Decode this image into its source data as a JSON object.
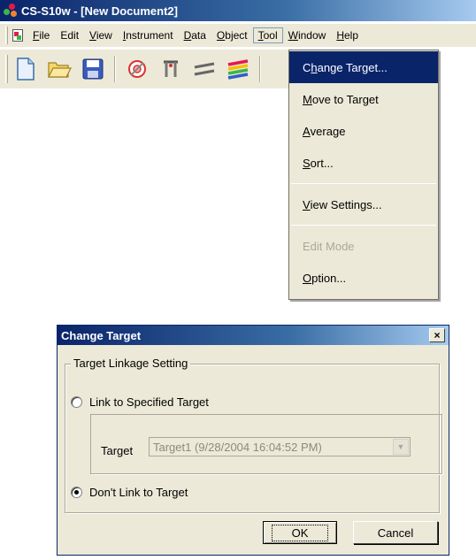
{
  "window": {
    "title": "CS-S10w - [New Document2]"
  },
  "menubar": {
    "items": [
      {
        "label": "File",
        "mnemonic": "F",
        "rest": "ile"
      },
      {
        "label": "Edit",
        "mnemonic": "",
        "rest": "Edit"
      },
      {
        "label": "View",
        "mnemonic": "V",
        "rest": "iew"
      },
      {
        "label": "Instrument",
        "mnemonic": "I",
        "rest": "nstrument"
      },
      {
        "label": "Data",
        "mnemonic": "D",
        "rest": "ata"
      },
      {
        "label": "Object",
        "mnemonic": "O",
        "rest": "bject"
      },
      {
        "label": "Tool",
        "mnemonic": "T",
        "rest": "ool"
      },
      {
        "label": "Window",
        "mnemonic": "W",
        "rest": "indow"
      },
      {
        "label": "Help",
        "mnemonic": "H",
        "rest": "elp"
      }
    ]
  },
  "toolbar": {
    "icons": [
      "new-document-icon",
      "open-folder-icon",
      "save-disk-icon",
      "target-icon",
      "instrument-icon",
      "lines-icon",
      "layers-icon"
    ]
  },
  "tool_menu": {
    "change_target": {
      "pre": "C",
      "mn": "h",
      "post": "ange Target..."
    },
    "move_to_target": {
      "pre": "",
      "mn": "M",
      "post": "ove to Target"
    },
    "average": {
      "pre": "",
      "mn": "A",
      "post": "verage"
    },
    "sort": {
      "pre": "",
      "mn": "S",
      "post": "ort..."
    },
    "view_settings": {
      "pre": "",
      "mn": "V",
      "post": "iew Settings..."
    },
    "edit_mode": {
      "pre": "",
      "mn": "",
      "post": "Edit Mode"
    },
    "option": {
      "pre": "",
      "mn": "O",
      "post": "ption..."
    }
  },
  "dialog": {
    "title": "Change Target",
    "close_glyph": "×",
    "group_label": "Target Linkage Setting",
    "radio_link": "Link to Specified Target",
    "target_label": "Target",
    "target_value": "Target1 (9/28/2004 16:04:52 PM)",
    "radio_dont_link": "Don't Link to Target",
    "ok_label": "OK",
    "cancel_label": "Cancel",
    "selected_option": "Don't Link to Target"
  },
  "colors": {
    "titlebar_start": "#0a246a",
    "titlebar_end": "#a6caf0",
    "menu_highlight": "#0a246a",
    "face": "#ece9d8"
  }
}
